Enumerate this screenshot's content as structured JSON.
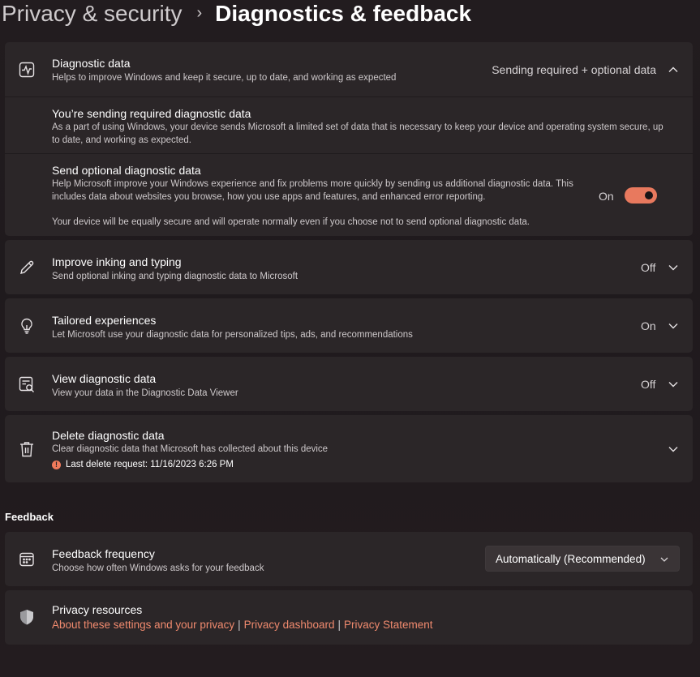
{
  "breadcrumb": {
    "parent": "Privacy & security",
    "separator": "›",
    "current": "Diagnostics & feedback"
  },
  "diagnostic_data": {
    "title": "Diagnostic data",
    "description": "Helps to improve Windows and keep it secure, up to date, and working as expected",
    "status": "Sending required + optional data",
    "icon": "heart-pulse-icon",
    "required": {
      "title": "You’re sending required diagnostic data",
      "description": "As a part of using Windows, your device sends Microsoft a limited set of data that is necessary to keep your device and operating system secure, up to date, and working as expected."
    },
    "optional": {
      "title": "Send optional diagnostic data",
      "description": "Help Microsoft improve your Windows experience and fix problems more quickly by sending us additional diagnostic data. This includes data about websites you browse, how you use apps and features, and enhanced error reporting.",
      "note": "Your device will be equally secure and will operate normally even if you choose not to send optional diagnostic data.",
      "toggle_label": "On",
      "toggle_on": true
    }
  },
  "inking": {
    "title": "Improve inking and typing",
    "description": "Send optional inking and typing diagnostic data to Microsoft",
    "status": "Off",
    "icon": "pen-icon"
  },
  "tailored": {
    "title": "Tailored experiences",
    "description": "Let Microsoft use your diagnostic data for personalized tips, ads, and recommendations",
    "status": "On",
    "icon": "lightbulb-icon"
  },
  "view_data": {
    "title": "View diagnostic data",
    "description": "View your data in the Diagnostic Data Viewer",
    "status": "Off",
    "icon": "document-search-icon"
  },
  "delete_data": {
    "title": "Delete diagnostic data",
    "description": "Clear diagnostic data that Microsoft has collected about this device",
    "last_request": "Last delete request: 11/16/2023 6:26 PM",
    "icon": "trash-icon",
    "badge_glyph": "!"
  },
  "feedback_section": {
    "header": "Feedback",
    "frequency": {
      "title": "Feedback frequency",
      "description": "Choose how often Windows asks for your feedback",
      "selected": "Automatically (Recommended)",
      "icon": "calendar-icon"
    }
  },
  "privacy_resources": {
    "title": "Privacy resources",
    "icon": "shield-icon",
    "links": [
      "About these settings and your privacy",
      "Privacy dashboard",
      "Privacy Statement"
    ],
    "link_separator": "|"
  },
  "colors": {
    "accent": "#e8795e",
    "link": "#f08a6e",
    "card": "#2b2628",
    "background": "#1f1a1d"
  }
}
